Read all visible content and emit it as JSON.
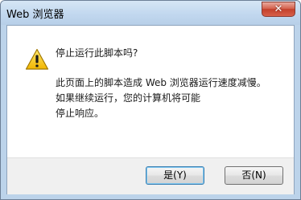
{
  "window": {
    "title": "Web 浏览器",
    "close_label": "✕"
  },
  "dialog": {
    "icon": "warning-icon",
    "heading": "停止运行此脚本吗?",
    "body_lines": [
      "此页面上的脚本造成 Web 浏览器运行速度减慢。",
      "如果继续运行，您的计算机将可能",
      "停止响应。"
    ]
  },
  "buttons": {
    "yes_label": "是(Y)",
    "no_label": "否(N)"
  },
  "colors": {
    "titlebar": "#c2d8ef",
    "close_button": "#c3402c",
    "footer": "#f0f0f0",
    "default_button_border": "#3c7fb1",
    "warning_yellow": "#f5c400"
  }
}
